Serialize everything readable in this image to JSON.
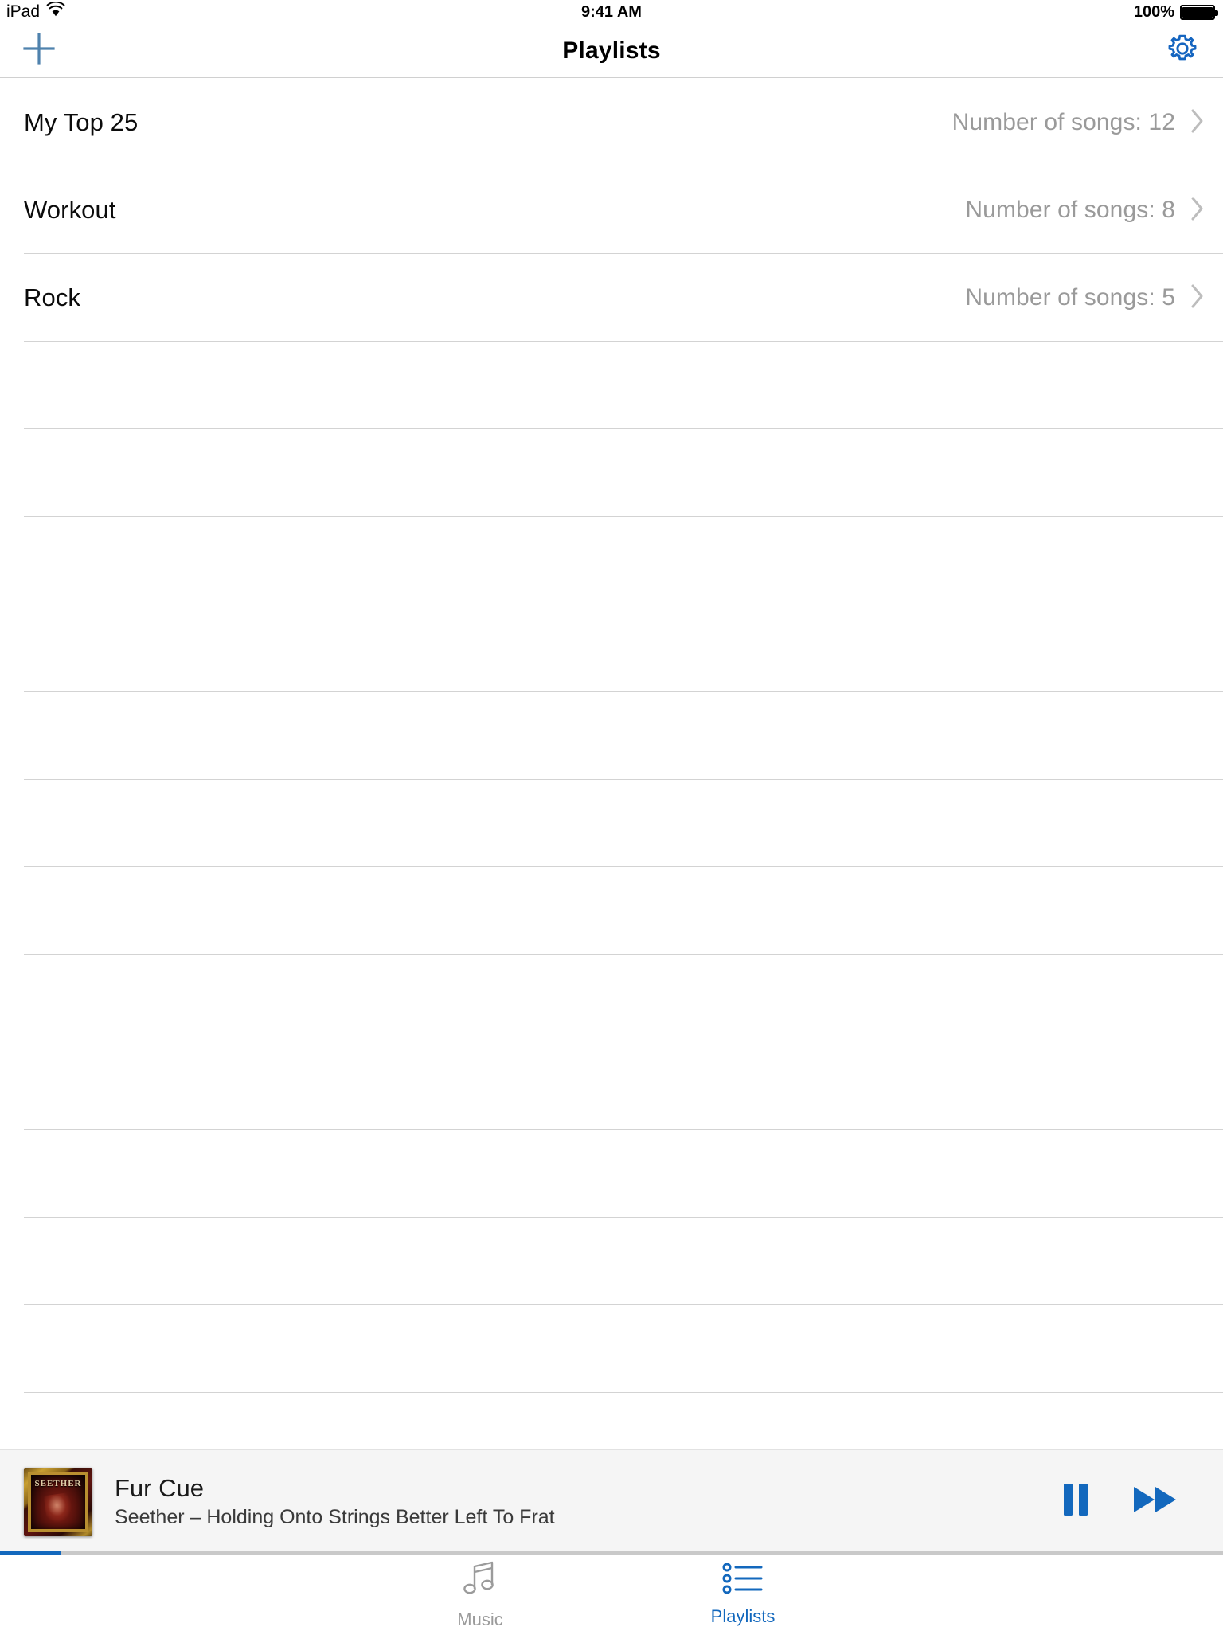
{
  "status_bar": {
    "device": "iPad",
    "wifi_icon": "wifi-icon",
    "time": "9:41 AM",
    "battery_percent": "100%",
    "battery_icon": "battery-full-icon"
  },
  "nav_bar": {
    "title": "Playlists",
    "add_icon": "plus-icon",
    "settings_icon": "gear-icon",
    "add_color": "#4f82ad",
    "settings_color": "#1565c0"
  },
  "playlists": {
    "rows": [
      {
        "name": "My Top 25",
        "detail": "Number of songs: 12",
        "chevron": "chevron-right-icon"
      },
      {
        "name": "Workout",
        "detail": "Number of songs: 8",
        "chevron": "chevron-right-icon"
      },
      {
        "name": "Rock",
        "detail": "Number of songs: 5",
        "chevron": "chevron-right-icon"
      }
    ],
    "empty_row_count": 13
  },
  "now_playing": {
    "album_art_label": "SEETHER",
    "track_title": "Fur Cue",
    "track_subtitle": "Seether – Holding Onto Strings Better Left To Frat",
    "pause_icon": "pause-icon",
    "next_icon": "fast-forward-icon",
    "control_color": "#1368bd",
    "progress_percent": 5
  },
  "tab_bar": {
    "tabs": [
      {
        "label": "Music",
        "icon": "music-note-icon",
        "active": false
      },
      {
        "label": "Playlists",
        "icon": "bulleted-list-icon",
        "active": true
      }
    ],
    "active_color": "#1368bd",
    "inactive_color": "#9b9b9b"
  }
}
